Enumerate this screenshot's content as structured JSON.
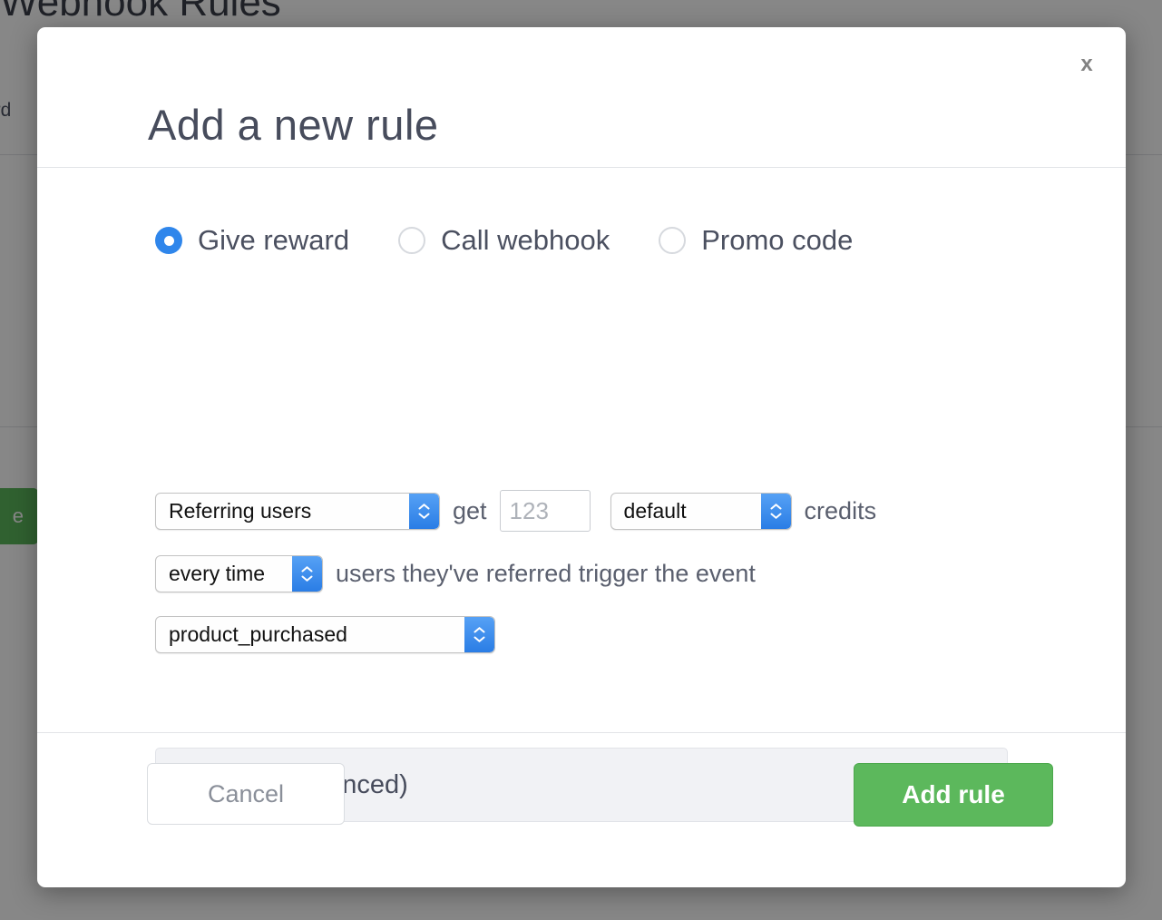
{
  "background": {
    "heading": "Webhook Rules",
    "partial_text": "ard ",
    "green_button_text": "e"
  },
  "modal": {
    "title": "Add a new rule",
    "close_label": "x",
    "rule_types": [
      {
        "label": "Give reward",
        "selected": true
      },
      {
        "label": "Call webhook",
        "selected": false
      },
      {
        "label": "Promo code",
        "selected": false
      }
    ],
    "form": {
      "row1": {
        "recipient_select": "Referring users",
        "get_label": "get",
        "amount_placeholder": "123",
        "amount_value": "",
        "unit_select": "default",
        "credits_label": "credits"
      },
      "row2": {
        "frequency_select": "every time",
        "frequency_text": "users they've referred trigger the event"
      },
      "row3": {
        "event_select": "product_purchased"
      }
    },
    "filter": {
      "label": "Filter (Advanced)",
      "expanded": false
    },
    "footer": {
      "cancel_label": "Cancel",
      "submit_label": "Add rule"
    }
  },
  "colors": {
    "accent_blue": "#2f86eb",
    "success_green": "#5cb85c",
    "title_text": "#474c5c",
    "panel_bg": "#f1f2f5"
  }
}
